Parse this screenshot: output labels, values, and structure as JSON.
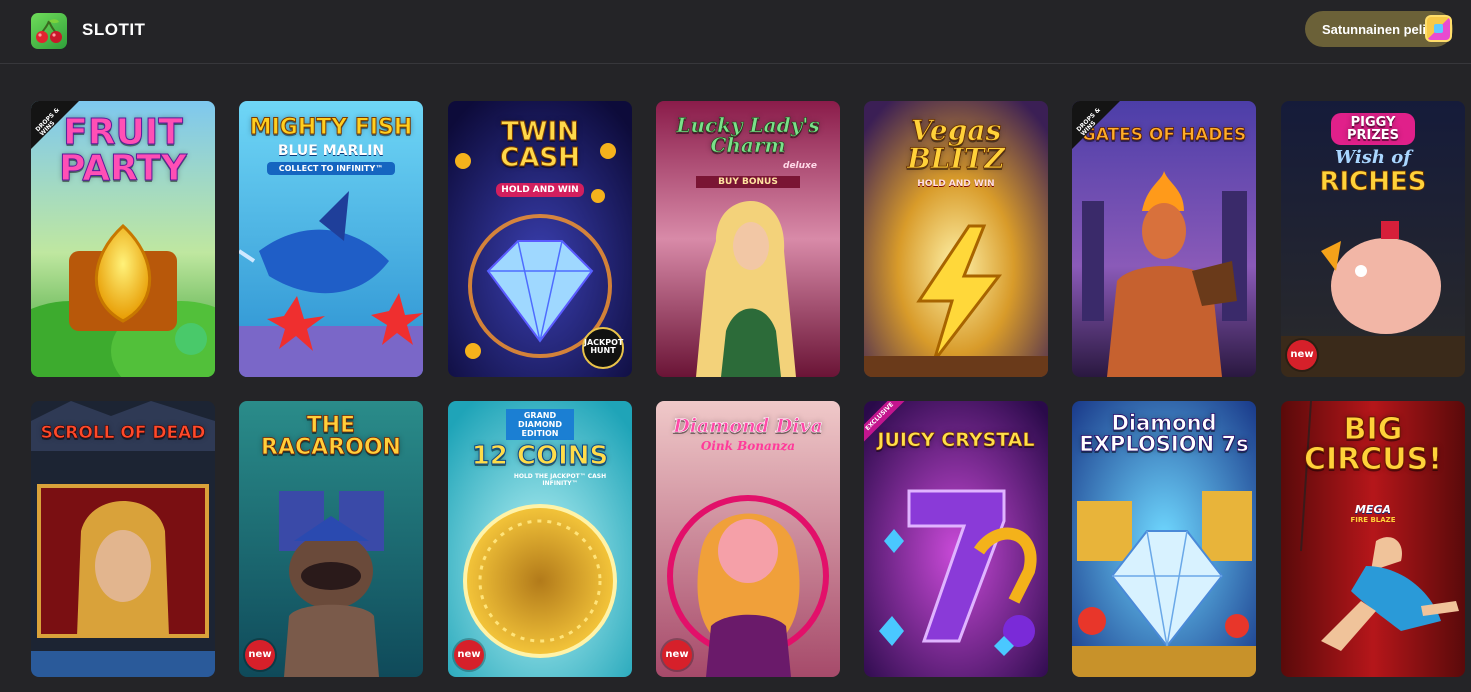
{
  "header": {
    "title": "SLOTIT",
    "random_label": "Satunnainen peli"
  },
  "games": [
    {
      "name": "Fruit Party",
      "logo": "FRUIT\nPARTY",
      "corner": "DROPS & WINS",
      "new": false
    },
    {
      "name": "Mighty Fish Blue Marlin",
      "logo": "MIGHTY FISH",
      "sub1": "BLUE MARLIN",
      "sub2": "COLLECT TO INFINITY™",
      "new": false
    },
    {
      "name": "Twin Cash Hold and Win",
      "logo": "TWIN\nCASH",
      "sub1": "HOLD AND WIN",
      "badge": "JACKPOT HUNT",
      "new": false
    },
    {
      "name": "Lucky Lady's Charm Deluxe Buy Bonus",
      "logo": "Lucky Lady's\nCharm",
      "sub1": "deluxe",
      "sub2": "BUY BONUS",
      "new": false
    },
    {
      "name": "Vegas Blitz Hold and Win",
      "logo": "Vegas\nBLITZ",
      "sub1": "HOLD AND WIN",
      "new": false
    },
    {
      "name": "Gates of Hades",
      "logo": "GATES OF HADES",
      "corner": "DROPS & WINS",
      "new": false
    },
    {
      "name": "Piggy Prizes Wish of Riches",
      "logo": "PIGGY PRIZES",
      "sub1": "Wish of",
      "sub2": "RICHES",
      "new": true
    },
    {
      "name": "Scroll of Dead",
      "logo": "SCROLL OF DEAD",
      "new": false
    },
    {
      "name": "The Racaroon",
      "logo": "THE\nRACAROON",
      "new": true
    },
    {
      "name": "12 Coins Grand Diamond Edition",
      "logo": "12 COINS",
      "sub1": "GRAND DIAMOND EDITION",
      "sub2": "HOLD THE JACKPOT™ CASH INFINITY™",
      "new": true
    },
    {
      "name": "Diamond Diva Oink Bonanza",
      "logo": "Diamond Diva",
      "sub1": "Oink Bonanza",
      "new": true
    },
    {
      "name": "Juicy Crystal",
      "logo": "JUICY CRYSTAL",
      "excl": "EXCLUSIVE",
      "new": false
    },
    {
      "name": "Diamond Explosion 7s",
      "logo": "Diamond\nEXPLOSION 7s",
      "new": false
    },
    {
      "name": "Big Circus! Mega Fire Blaze",
      "logo": "BIG\nCIRCUS!",
      "sub1": "MEGA",
      "sub2": "FIRE BLAZE",
      "new": false
    }
  ],
  "new_label": "new",
  "icons": {
    "section": "cherries-icon",
    "random": "dice-icon"
  },
  "colors": {
    "background": "#242427",
    "random_button": "#6b6138",
    "new_badge": "#d6202a"
  }
}
